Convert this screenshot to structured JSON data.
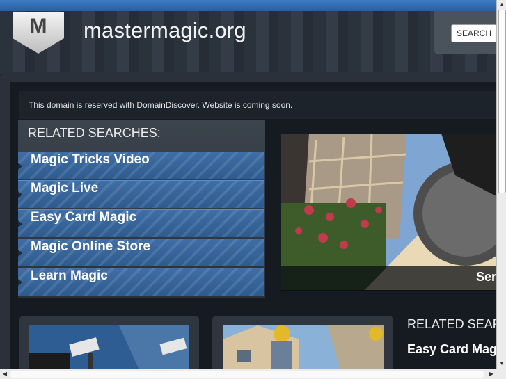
{
  "header": {
    "logo_letter": "M",
    "site_title": "mastermagic.org",
    "search_label": "SEARCH"
  },
  "notice": {
    "text": "This domain is reserved with DomainDiscover. Website is coming soon."
  },
  "related": {
    "heading": "RELATED SEARCHES:",
    "items": [
      {
        "label": "Magic Tricks Video"
      },
      {
        "label": "Magic Live"
      },
      {
        "label": "Easy Card Magic"
      },
      {
        "label": "Magic Online Store"
      },
      {
        "label": "Learn Magic"
      }
    ]
  },
  "feature": {
    "caption": "Ser"
  },
  "related_secondary": {
    "heading": "RELATED SEAR",
    "first_item": "Easy Card Mag"
  },
  "colors": {
    "accent_blue": "#2e5b8f",
    "background": "#1c232c"
  }
}
